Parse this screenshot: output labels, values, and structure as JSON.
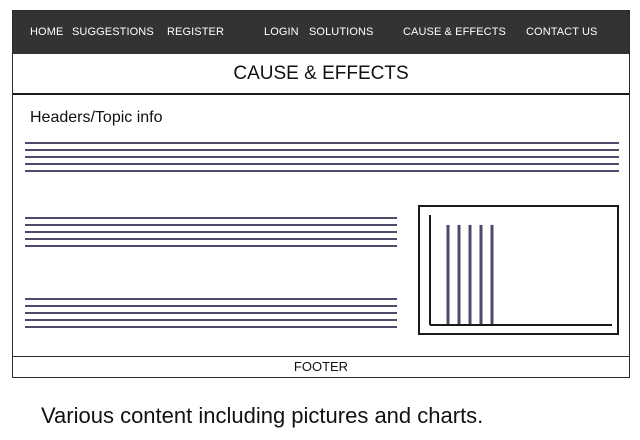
{
  "nav": {
    "items": [
      {
        "label": "HOME"
      },
      {
        "label": "SUGGESTIONS"
      },
      {
        "label": "REGISTER"
      },
      {
        "label": "LOGIN"
      },
      {
        "label": "SOLUTIONS"
      },
      {
        "label": "CAUSE & EFFECTS"
      },
      {
        "label": "CONTACT US"
      }
    ]
  },
  "page": {
    "title": "CAUSE & EFFECTS",
    "topic_heading": "Headers/Topic info",
    "footer": "FOOTER",
    "caption": "Various content including pictures and charts."
  },
  "colors": {
    "nav_background": "#333333",
    "nav_text": "#ffffff",
    "placeholder_lines": "#4f4a6b",
    "chart_bars": "#4f4a6b",
    "border": "#1a1a1a"
  },
  "chart_data": {
    "type": "bar",
    "categories": [
      "",
      "",
      "",
      "",
      ""
    ],
    "values": [
      1,
      1,
      1,
      1,
      1
    ],
    "title": "",
    "xlabel": "",
    "ylabel": "",
    "ylim": [
      0,
      1.1
    ],
    "grid": false
  }
}
